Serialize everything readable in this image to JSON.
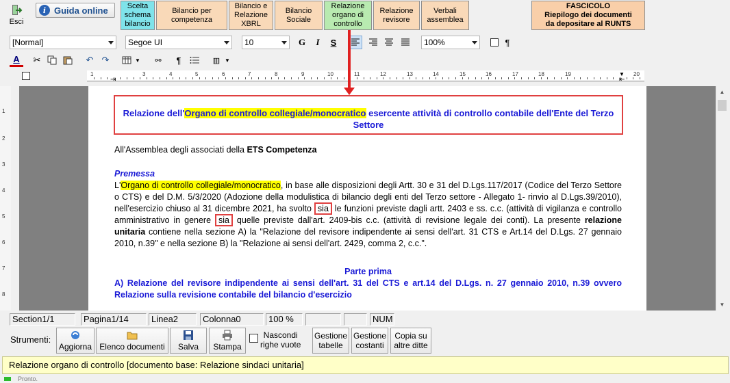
{
  "topbar": {
    "esci": "Esci",
    "guida": "Guida online",
    "tabs": [
      {
        "line1": "Scelta",
        "line2": "schema",
        "line3": "bilancio",
        "color": "#7fe3ea"
      },
      {
        "line1": "Bilancio per",
        "line2": "competenza",
        "line3": "",
        "color": "#f9d9b8"
      },
      {
        "line1": "Bilancio e",
        "line2": "Relazione",
        "line3": "XBRL",
        "color": "#f9d9b8"
      },
      {
        "line1": "Bilancio",
        "line2": "Sociale",
        "line3": "",
        "color": "#f9d9b8"
      },
      {
        "line1": "Relazione",
        "line2": "organo di",
        "line3": "controllo",
        "color": "#b8eab0"
      },
      {
        "line1": "Relazione",
        "line2": "revisore",
        "line3": "",
        "color": "#f9d9b8"
      },
      {
        "line1": "Verbali",
        "line2": "assemblea",
        "line3": "",
        "color": "#f9d9b8"
      }
    ],
    "fascicolo": {
      "line1": "FASCICOLO",
      "line2": "Riepilogo dei documenti",
      "line3": "da depositare al RUNTS"
    }
  },
  "format": {
    "style": "[Normal]",
    "font": "Segoe UI",
    "size": "10",
    "bold": "G",
    "italic": "I",
    "underline": "S",
    "zoom": "100%",
    "pilcrow": "¶"
  },
  "ruler": {
    "numbers": [
      "1",
      "2",
      "3",
      "4",
      "5",
      "6",
      "7",
      "8",
      "9",
      "10",
      "11",
      "12",
      "13",
      "14",
      "15",
      "16",
      "17",
      "18",
      "19",
      "20"
    ]
  },
  "vruler": {
    "numbers": [
      "1",
      "2",
      "3",
      "4",
      "5",
      "6",
      "7",
      "8"
    ]
  },
  "document": {
    "title_pre": "Relazione dell'",
    "title_hl": "Organo di controllo collegiale/monocratico",
    "title_post": " esercente attività di controllo contabile dell'Ente del Terzo Settore",
    "assemblea_pre": "All'Assemblea degli associati della ",
    "assemblea_bold": "ETS Competenza",
    "premessa": "Premessa",
    "p1_hl": "Organo di controllo collegiale/monocratico",
    "p1_pre": "L'",
    "p1_a": ", in base alle disposizioni degli Artt. 30 e 31 del D.Lgs.117/2017 (Codice del Terzo Settore o CTS) e del D.M. 5/3/2020 (Adozione della modulistica di bilancio degli enti del Terzo settore - Allegato 1- rinvio al D.Lgs.39/2010), nell'esercizio chiuso al 31 dicembre 2021, ha svolto ",
    "sia1": "sia",
    "p1_b": " le funzioni previste dagli artt. 2403 e ss. c.c. (attività di vigilanza e controllo amministrativo in genere ",
    "sia2": "sia",
    "p1_c": " quelle previste dall'art. 2409-bis c.c. (attività di revisione legale dei conti). La presente ",
    "p1_bold": "relazione unitaria",
    "p1_d": " contiene nella sezione A) la \"Relazione del revisore indipendente ai sensi dell'art. 31 CTS e Art.14 del D.Lgs. 27 gennaio 2010, n.39\" e nella sezione B) la \"Relazione ai sensi dell'art. 2429, comma 2, c.c.\".",
    "parte_prima": "Parte prima",
    "sez_a": "A) Relazione del revisore indipendente ai sensi dell'art. 31 del CTS e art.14 del D.Lgs. n. 27 gennaio 2010, n.39 ovvero Relazione sulla revisione contabile del bilancio d'esercizio"
  },
  "status": {
    "section": "Section1/1",
    "page": "Pagina1/14",
    "line": "Linea2",
    "column": "Colonna0",
    "zoom": "100 %",
    "num": "NUM"
  },
  "tools": {
    "label": "Strumenti:",
    "aggiorna": "Aggiorna",
    "elenco": "Elenco documenti",
    "salva": "Salva",
    "stampa": "Stampa",
    "nascondi1": "Nascondi",
    "nascondi2": "righe vuote",
    "gestione_tabelle1": "Gestione",
    "gestione_tabelle2": "tabelle",
    "gestione_costanti1": "Gestione",
    "gestione_costanti2": "costanti",
    "copia1": "Copia su",
    "copia2": "altre ditte"
  },
  "infobar": "Relazione organo di controllo [documento base: Relazione sindaci unitaria]",
  "bottom": "Pronto."
}
